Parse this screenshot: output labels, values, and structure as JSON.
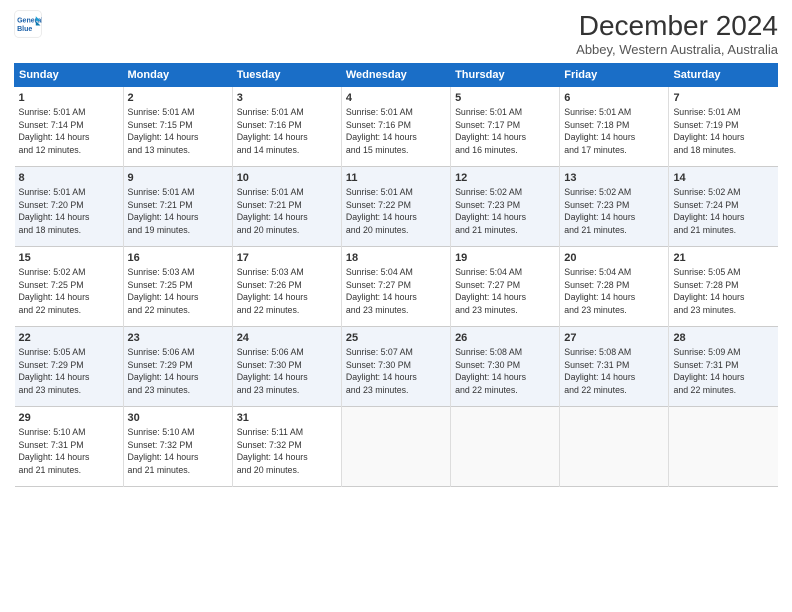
{
  "header": {
    "logo_line1": "General",
    "logo_line2": "Blue",
    "main_title": "December 2024",
    "subtitle": "Abbey, Western Australia, Australia"
  },
  "calendar": {
    "days_of_week": [
      "Sunday",
      "Monday",
      "Tuesday",
      "Wednesday",
      "Thursday",
      "Friday",
      "Saturday"
    ],
    "weeks": [
      [
        {
          "day": "1",
          "sunrise": "5:01 AM",
          "sunset": "7:14 PM",
          "daylight": "14 hours and 12 minutes."
        },
        {
          "day": "2",
          "sunrise": "5:01 AM",
          "sunset": "7:15 PM",
          "daylight": "14 hours and 13 minutes."
        },
        {
          "day": "3",
          "sunrise": "5:01 AM",
          "sunset": "7:16 PM",
          "daylight": "14 hours and 14 minutes."
        },
        {
          "day": "4",
          "sunrise": "5:01 AM",
          "sunset": "7:16 PM",
          "daylight": "14 hours and 15 minutes."
        },
        {
          "day": "5",
          "sunrise": "5:01 AM",
          "sunset": "7:17 PM",
          "daylight": "14 hours and 16 minutes."
        },
        {
          "day": "6",
          "sunrise": "5:01 AM",
          "sunset": "7:18 PM",
          "daylight": "14 hours and 17 minutes."
        },
        {
          "day": "7",
          "sunrise": "5:01 AM",
          "sunset": "7:19 PM",
          "daylight": "14 hours and 18 minutes."
        }
      ],
      [
        {
          "day": "8",
          "sunrise": "5:01 AM",
          "sunset": "7:20 PM",
          "daylight": "14 hours and 18 minutes."
        },
        {
          "day": "9",
          "sunrise": "5:01 AM",
          "sunset": "7:21 PM",
          "daylight": "14 hours and 19 minutes."
        },
        {
          "day": "10",
          "sunrise": "5:01 AM",
          "sunset": "7:21 PM",
          "daylight": "14 hours and 20 minutes."
        },
        {
          "day": "11",
          "sunrise": "5:01 AM",
          "sunset": "7:22 PM",
          "daylight": "14 hours and 20 minutes."
        },
        {
          "day": "12",
          "sunrise": "5:02 AM",
          "sunset": "7:23 PM",
          "daylight": "14 hours and 21 minutes."
        },
        {
          "day": "13",
          "sunrise": "5:02 AM",
          "sunset": "7:23 PM",
          "daylight": "14 hours and 21 minutes."
        },
        {
          "day": "14",
          "sunrise": "5:02 AM",
          "sunset": "7:24 PM",
          "daylight": "14 hours and 21 minutes."
        }
      ],
      [
        {
          "day": "15",
          "sunrise": "5:02 AM",
          "sunset": "7:25 PM",
          "daylight": "14 hours and 22 minutes."
        },
        {
          "day": "16",
          "sunrise": "5:03 AM",
          "sunset": "7:25 PM",
          "daylight": "14 hours and 22 minutes."
        },
        {
          "day": "17",
          "sunrise": "5:03 AM",
          "sunset": "7:26 PM",
          "daylight": "14 hours and 22 minutes."
        },
        {
          "day": "18",
          "sunrise": "5:04 AM",
          "sunset": "7:27 PM",
          "daylight": "14 hours and 23 minutes."
        },
        {
          "day": "19",
          "sunrise": "5:04 AM",
          "sunset": "7:27 PM",
          "daylight": "14 hours and 23 minutes."
        },
        {
          "day": "20",
          "sunrise": "5:04 AM",
          "sunset": "7:28 PM",
          "daylight": "14 hours and 23 minutes."
        },
        {
          "day": "21",
          "sunrise": "5:05 AM",
          "sunset": "7:28 PM",
          "daylight": "14 hours and 23 minutes."
        }
      ],
      [
        {
          "day": "22",
          "sunrise": "5:05 AM",
          "sunset": "7:29 PM",
          "daylight": "14 hours and 23 minutes."
        },
        {
          "day": "23",
          "sunrise": "5:06 AM",
          "sunset": "7:29 PM",
          "daylight": "14 hours and 23 minutes."
        },
        {
          "day": "24",
          "sunrise": "5:06 AM",
          "sunset": "7:30 PM",
          "daylight": "14 hours and 23 minutes."
        },
        {
          "day": "25",
          "sunrise": "5:07 AM",
          "sunset": "7:30 PM",
          "daylight": "14 hours and 23 minutes."
        },
        {
          "day": "26",
          "sunrise": "5:08 AM",
          "sunset": "7:30 PM",
          "daylight": "14 hours and 22 minutes."
        },
        {
          "day": "27",
          "sunrise": "5:08 AM",
          "sunset": "7:31 PM",
          "daylight": "14 hours and 22 minutes."
        },
        {
          "day": "28",
          "sunrise": "5:09 AM",
          "sunset": "7:31 PM",
          "daylight": "14 hours and 22 minutes."
        }
      ],
      [
        {
          "day": "29",
          "sunrise": "5:10 AM",
          "sunset": "7:31 PM",
          "daylight": "14 hours and 21 minutes."
        },
        {
          "day": "30",
          "sunrise": "5:10 AM",
          "sunset": "7:32 PM",
          "daylight": "14 hours and 21 minutes."
        },
        {
          "day": "31",
          "sunrise": "5:11 AM",
          "sunset": "7:32 PM",
          "daylight": "14 hours and 20 minutes."
        },
        null,
        null,
        null,
        null
      ]
    ],
    "label_sunrise": "Sunrise:",
    "label_sunset": "Sunset:",
    "label_daylight": "Daylight:"
  }
}
